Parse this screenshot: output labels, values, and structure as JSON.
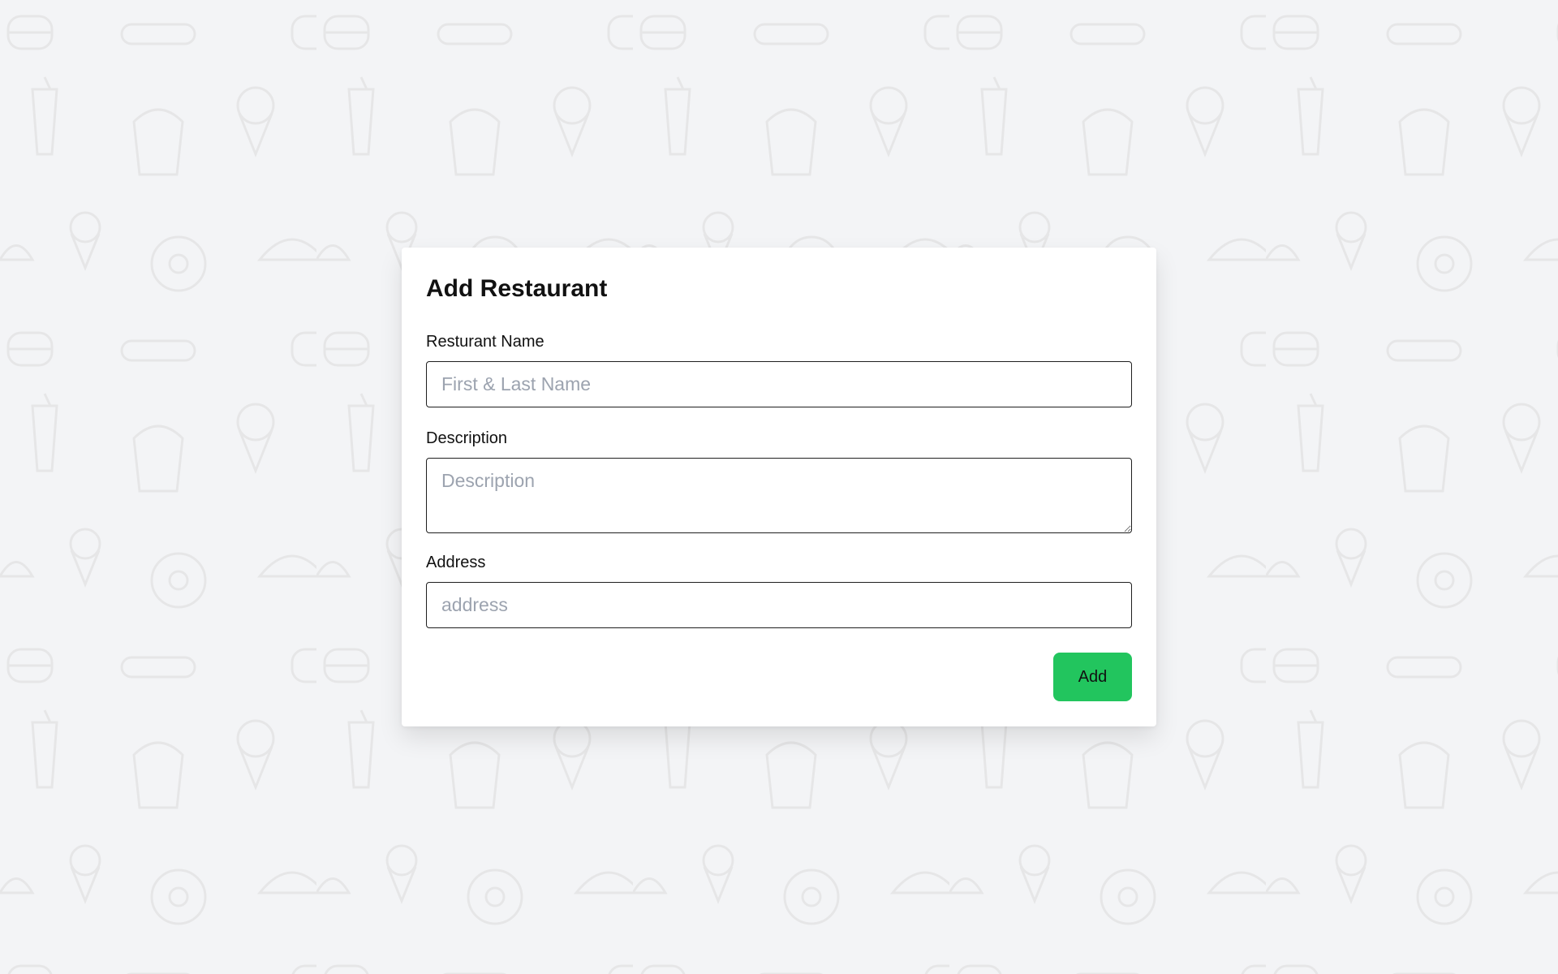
{
  "form": {
    "title": "Add Restaurant",
    "name_label": "Resturant Name",
    "name_placeholder": "First & Last Name",
    "name_value": "",
    "description_label": "Description",
    "description_placeholder": "Description",
    "description_value": "",
    "address_label": "Address",
    "address_placeholder": "address",
    "address_value": "",
    "submit_label": "Add"
  },
  "colors": {
    "background": "#f3f4f6",
    "card": "#ffffff",
    "accent_button": "#22c55e",
    "pattern": "#e4e4e4"
  },
  "background_icons": [
    "burger-icon",
    "fries-icon",
    "soda-cup-icon",
    "ice-cream-icon",
    "taco-icon",
    "donut-icon",
    "sandwich-icon"
  ]
}
